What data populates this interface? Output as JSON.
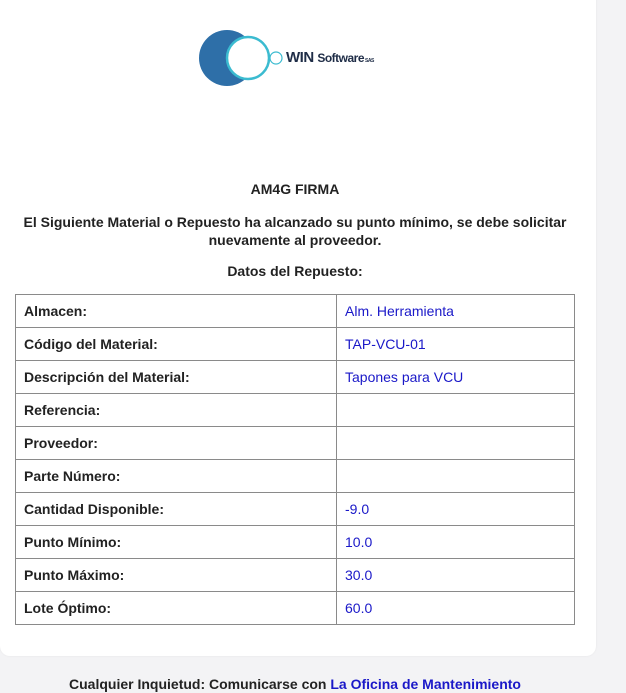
{
  "logo": {
    "brand_bold": "WIN",
    "brand_rest": "Software",
    "brand_suffix": "SAS"
  },
  "title": "AM4G FIRMA",
  "message": "El Siguiente Material o Repuesto ha alcanzado su punto mínimo, se debe solicitar nuevamente al proveedor.",
  "subtitle": "Datos del Repuesto:",
  "rows": [
    {
      "label": "Almacen:",
      "value": "Alm. Herramienta"
    },
    {
      "label": "Código del Material:",
      "value": "TAP-VCU-01"
    },
    {
      "label": "Descripción del Material:",
      "value": "Tapones para VCU"
    },
    {
      "label": "Referencia:",
      "value": ""
    },
    {
      "label": "Proveedor:",
      "value": ""
    },
    {
      "label": "Parte Número:",
      "value": ""
    },
    {
      "label": "Cantidad Disponible:",
      "value": "-9.0"
    },
    {
      "label": "Punto Mínimo:",
      "value": "10.0"
    },
    {
      "label": "Punto Máximo:",
      "value": "30.0"
    },
    {
      "label": "Lote Óptimo:",
      "value": "60.0"
    }
  ],
  "footer": {
    "text": "Cualquier Inquietud: Comunicarse con ",
    "link": "La Oficina de Mantenimiento"
  },
  "colors": {
    "value_text": "#1a18c8",
    "logo_blue": "#2e6fa8",
    "logo_teal": "#3bbbd0",
    "logo_text": "#1f2d47"
  }
}
